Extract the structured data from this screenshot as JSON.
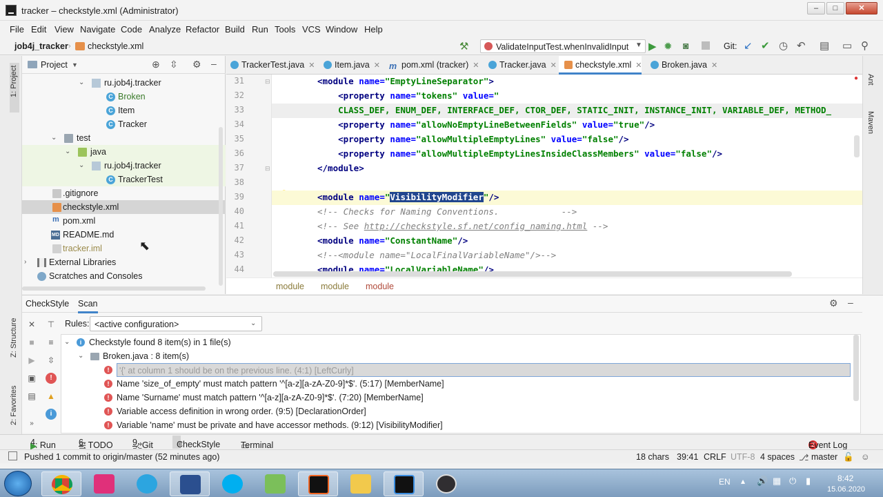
{
  "window": {
    "title": "tracker – checkstyle.xml (Administrator)",
    "minimize": "–",
    "maximize": "□",
    "close": "✕"
  },
  "menu": [
    "File",
    "Edit",
    "View",
    "Navigate",
    "Code",
    "Analyze",
    "Refactor",
    "Build",
    "Run",
    "Tools",
    "VCS",
    "Window",
    "Help"
  ],
  "navbar": {
    "project": "job4j_tracker",
    "file": "checkstyle.xml",
    "run_config": "ValidateInputTest.whenInvalidInput",
    "git_label": "Git:"
  },
  "left_strip": {
    "project": "1: Project",
    "structure": "Z: Structure",
    "favorites": "2: Favorites"
  },
  "right_strip": {
    "ant": "Ant",
    "maven": "Maven"
  },
  "project_panel": {
    "title": "Project",
    "items": [
      {
        "label": "ru.job4j.tracker",
        "kind": "package"
      },
      {
        "label": "Broken",
        "kind": "class"
      },
      {
        "label": "Item",
        "kind": "class"
      },
      {
        "label": "Tracker",
        "kind": "class"
      },
      {
        "label": "test",
        "kind": "folder"
      },
      {
        "label": "java",
        "kind": "folder-green"
      },
      {
        "label": "ru.job4j.tracker",
        "kind": "package"
      },
      {
        "label": "TrackerTest",
        "kind": "class"
      },
      {
        "label": ".gitignore",
        "kind": "file"
      },
      {
        "label": "checkstyle.xml",
        "kind": "xml"
      },
      {
        "label": "pom.xml",
        "kind": "maven"
      },
      {
        "label": "README.md",
        "kind": "md"
      },
      {
        "label": "tracker.iml",
        "kind": "iml"
      },
      {
        "label": "External Libraries",
        "kind": "lib"
      },
      {
        "label": "Scratches and Consoles",
        "kind": "scratch"
      }
    ]
  },
  "editor": {
    "tabs": [
      {
        "label": "TrackerTest.java"
      },
      {
        "label": "Item.java"
      },
      {
        "label": "pom.xml (tracker)"
      },
      {
        "label": "Tracker.java"
      },
      {
        "label": "checkstyle.xml"
      },
      {
        "label": "Broken.java"
      }
    ],
    "line_numbers": [
      "31",
      "32",
      "33",
      "34",
      "35",
      "36",
      "37",
      "38",
      "39",
      "40",
      "41",
      "42",
      "43",
      "44"
    ],
    "lines": {
      "l31_a": "<module ",
      "l31_b": "name=",
      "l31_c": "\"EmptyLineSeparator\"",
      "l31_d": ">",
      "l32_a": "    <property ",
      "l32_b": "name=",
      "l32_c": "\"tokens\" ",
      "l32_d": "value=",
      "l32_e": "\"",
      "l33": "    CLASS_DEF, ENUM_DEF, INTERFACE_DEF, CTOR_DEF, STATIC_INIT, INSTANCE_INIT, VARIABLE_DEF, METHOD_",
      "l34_a": "    <property ",
      "l34_b": "name=",
      "l34_c": "\"allowNoEmptyLineBetweenFields\" ",
      "l34_d": "value=",
      "l34_e": "\"true\"",
      "l34_f": "/>",
      "l35_a": "    <property ",
      "l35_b": "name=",
      "l35_c": "\"allowMultipleEmptyLines\" ",
      "l35_d": "value=",
      "l35_e": "\"false\"",
      "l35_f": "/>",
      "l36_a": "    <property ",
      "l36_b": "name=",
      "l36_c": "\"allowMultipleEmptyLinesInsideClassMembers\" ",
      "l36_d": "value=",
      "l36_e": "\"false\"",
      "l36_f": "/>",
      "l37": "</module>",
      "l39_a": "<module ",
      "l39_b": "name=",
      "l39_c": "\"",
      "l39_sel": "VisibilityModifier",
      "l39_d": "\"",
      "l39_e": "/>",
      "l40": "<!-- Checks for Naming Conventions.            -->",
      "l41_a": "<!-- See ",
      "l41_link": "http://checkstyle.sf.net/config_naming.html",
      "l41_b": " -->",
      "l42_a": "<module ",
      "l42_b": "name=",
      "l42_c": "\"ConstantName\"",
      "l42_d": "/>",
      "l43": "<!--<module name=\"LocalFinalVariableName\"/>-->",
      "l44_a": "<module ",
      "l44_b": "name=",
      "l44_c": "\"LocalVariableName\"",
      "l44_d": "/>"
    },
    "breadcrumb": [
      "module",
      "module",
      "module"
    ]
  },
  "checkstyle": {
    "tabs": [
      "CheckStyle",
      "Scan"
    ],
    "rules_label": "Rules:",
    "rules_value": "<active configuration>",
    "summary": "Checkstyle found 8 item(s) in 1 file(s)",
    "file": "Broken.java : 8 item(s)",
    "items": [
      "'{' at column 1 should be on the previous line. (4:1) [LeftCurly]",
      "Name 'size_of_empty' must match pattern '^[a-z][a-zA-Z0-9]*$'. (5:17) [MemberName]",
      "Name 'Surname' must match pattern '^[a-z][a-zA-Z0-9]*$'. (7:20) [MemberName]",
      "Variable access definition in wrong order. (9:5) [DeclarationOrder]",
      "Variable 'name' must be private and have accessor methods. (9:12) [VisibilityModifier]"
    ]
  },
  "tool_windows": [
    {
      "num": "4",
      "label": ": Run"
    },
    {
      "num": "6",
      "label": ": TODO"
    },
    {
      "num": "9",
      "label": ": Git"
    },
    {
      "num": "",
      "label": "CheckStyle"
    },
    {
      "num": "",
      "label": "Terminal"
    }
  ],
  "event_log": {
    "count": "2",
    "label": "Event Log"
  },
  "status": {
    "message": "Pushed 1 commit to origin/master (52 minutes ago)",
    "chars": "18 chars",
    "position": "39:41",
    "line_sep": "CRLF",
    "encoding": "UTF-8",
    "indent": "4 spaces",
    "branch": "master"
  },
  "taskbar": {
    "lang": "EN",
    "time": "8:42",
    "date": "15.06.2020"
  },
  "colors": {
    "accent": "#4083c9",
    "error": "#e05555",
    "xml_tag": "#000080",
    "xml_value": "#008000"
  }
}
